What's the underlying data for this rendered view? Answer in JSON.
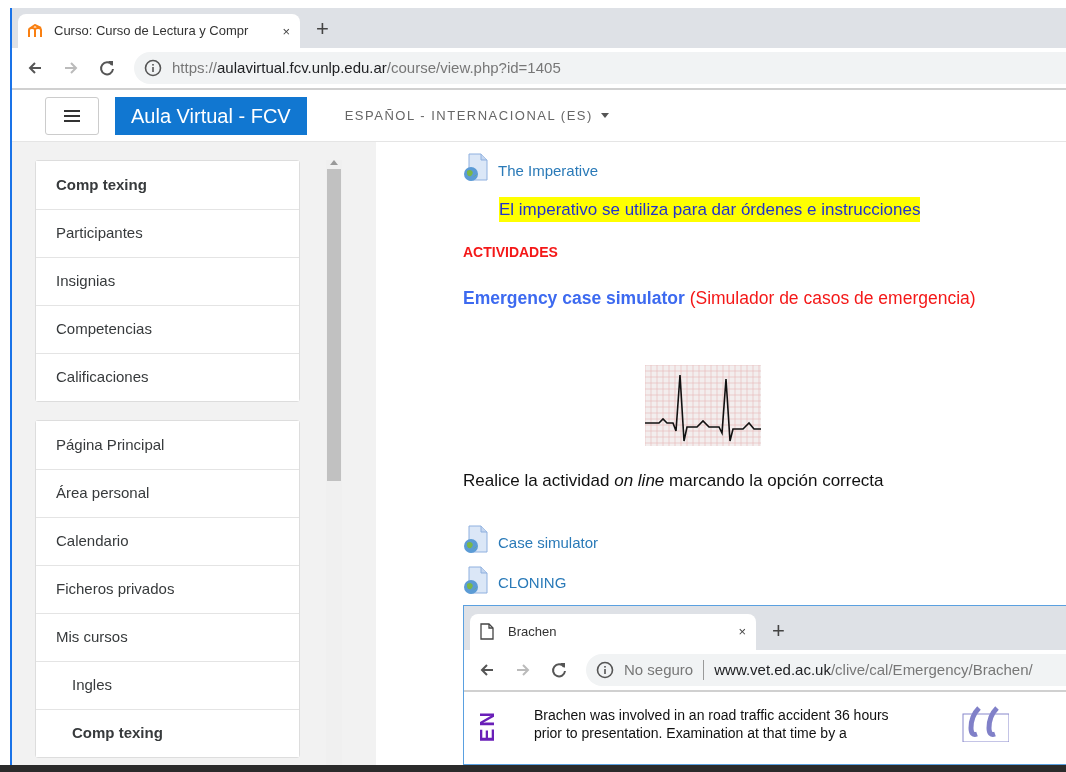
{
  "browser": {
    "tab_title": "Curso: Curso de Lectura y Compr",
    "tab_close": "×",
    "new_tab": "+",
    "url": {
      "scheme": "https://",
      "host": "aulavirtual.fcv.unlp.edu.ar",
      "path": "/course/view.php?id=1405"
    }
  },
  "navbar": {
    "brand": "Aula Virtual - FCV",
    "language": "ESPAÑOL - INTERNACIONAL (ES)"
  },
  "sidebar": {
    "blocks": [
      {
        "items": [
          {
            "label": "Comp texing",
            "selected": true
          },
          {
            "label": "Participantes",
            "selected": false
          },
          {
            "label": "Insignias",
            "selected": false
          },
          {
            "label": "Competencias",
            "selected": false
          },
          {
            "label": "Calificaciones",
            "selected": false
          }
        ]
      },
      {
        "items": [
          {
            "label": "Página Principal",
            "selected": false
          },
          {
            "label": "Área personal",
            "selected": false
          },
          {
            "label": "Calendario",
            "selected": false
          },
          {
            "label": "Ficheros privados",
            "selected": false
          },
          {
            "label": "Mis cursos",
            "selected": false,
            "children": [
              {
                "label": "Ingles",
                "selected": false
              },
              {
                "label": "Comp texing",
                "selected": true
              }
            ]
          }
        ]
      }
    ]
  },
  "content": [
    {
      "kind": "link",
      "text": "The Imperative"
    },
    {
      "kind": "highlight",
      "text": "El imperativo se utiliza para dar órdenes e instrucciones"
    },
    {
      "kind": "heading",
      "text": "ACTIVIDADES"
    },
    {
      "kind": "activity",
      "title": "Emergency case simulator",
      "subtitle": "(Simulador de casos de emergencia)"
    },
    {
      "kind": "image"
    },
    {
      "kind": "paragraph",
      "text": "Realice la actividad *on line* marcando la opción correcta"
    },
    {
      "kind": "link",
      "text": "Case simulator"
    },
    {
      "kind": "link",
      "text": "CLONING"
    },
    {
      "kind": "screenshot",
      "tab_title": "Brachen",
      "tab_close": "×",
      "new_tab": "+",
      "security": "No seguro",
      "url_host": "www.vet.ed.ac.uk",
      "url_path": "/clive/cal/Emergency/Brachen/",
      "side_title": "EN",
      "body": "Brachen was involved in an road traffic accident 36 hours prior to presentation. Examination at that time by a"
    }
  ]
}
